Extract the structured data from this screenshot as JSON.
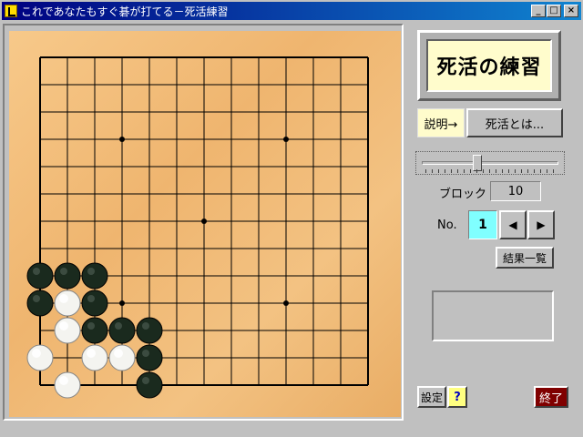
{
  "window": {
    "title": "これであなたもすぐ碁が打てる－死活練習",
    "minimize": "_",
    "maximize": "□",
    "close": "×"
  },
  "board": {
    "size": 13,
    "star_points": [
      [
        3,
        3
      ],
      [
        3,
        9
      ],
      [
        6,
        6
      ],
      [
        9,
        3
      ],
      [
        9,
        9
      ]
    ],
    "stones": [
      {
        "c": "b",
        "x": 0,
        "y": 8
      },
      {
        "c": "b",
        "x": 1,
        "y": 8
      },
      {
        "c": "b",
        "x": 2,
        "y": 8
      },
      {
        "c": "b",
        "x": 0,
        "y": 9
      },
      {
        "c": "w",
        "x": 1,
        "y": 9
      },
      {
        "c": "b",
        "x": 2,
        "y": 9
      },
      {
        "c": "w",
        "x": 1,
        "y": 10
      },
      {
        "c": "b",
        "x": 2,
        "y": 10
      },
      {
        "c": "b",
        "x": 3,
        "y": 10
      },
      {
        "c": "b",
        "x": 4,
        "y": 10
      },
      {
        "c": "w",
        "x": 0,
        "y": 11
      },
      {
        "c": "w",
        "x": 2,
        "y": 11
      },
      {
        "c": "w",
        "x": 3,
        "y": 11
      },
      {
        "c": "b",
        "x": 4,
        "y": 11
      },
      {
        "c": "w",
        "x": 1,
        "y": 12
      },
      {
        "c": "b",
        "x": 4,
        "y": 12
      }
    ]
  },
  "panel": {
    "heading": "死活の練習",
    "explain_label": "説明→",
    "explain_button": "死活とは...",
    "level": 0.4,
    "block_label": "ブロック",
    "block_value": "10",
    "no_label": "No.",
    "no_value": "1",
    "prev_icon": "◀",
    "next_icon": "▶",
    "results_button": "結果一覧",
    "message": "",
    "settings_button": "設定",
    "help_button": "?",
    "exit_button": "終了"
  }
}
